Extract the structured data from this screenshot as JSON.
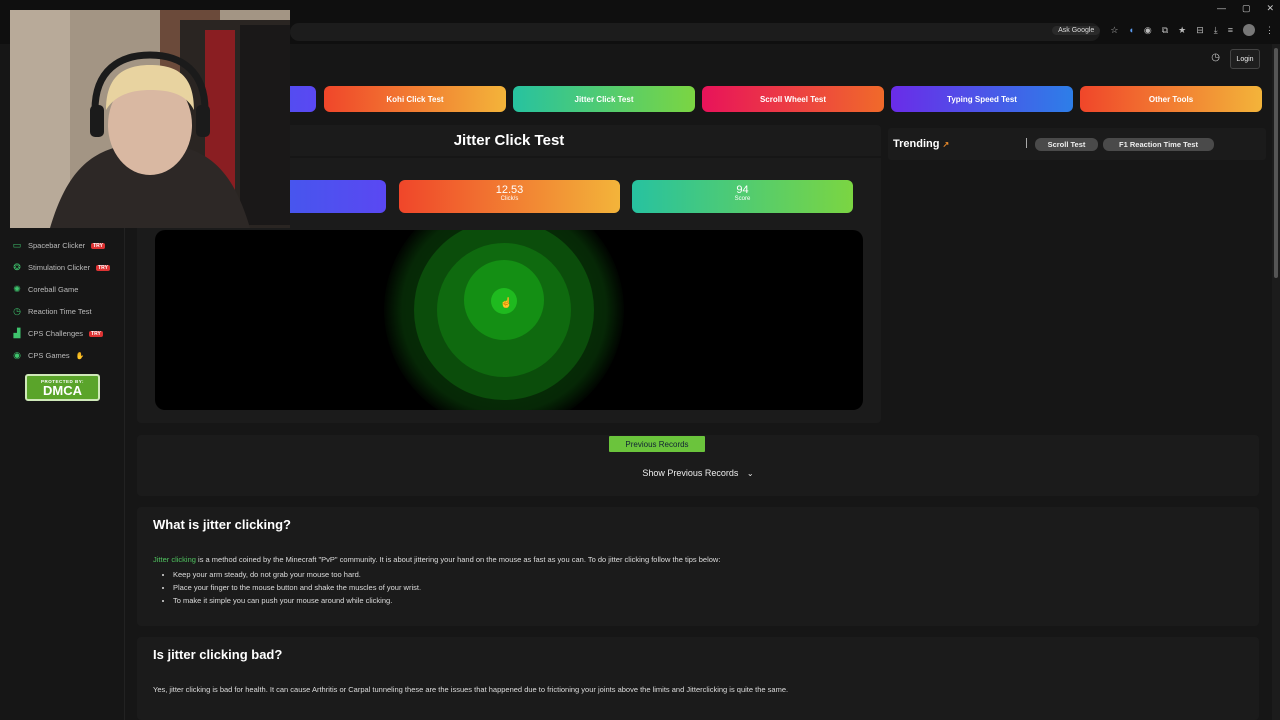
{
  "browser": {
    "window_controls": [
      "—",
      "▢",
      "✕"
    ],
    "ask_google": "Ask Google"
  },
  "header": {
    "history_icon": "history-icon",
    "login_label": "Login"
  },
  "nav_tabs": [
    {
      "label": "",
      "color_from": "#2f67e8",
      "color_to": "#5a48f2"
    },
    {
      "label": "Kohi Click Test",
      "color_from": "#f0462a",
      "color_to": "#f3b43a"
    },
    {
      "label": "Jitter Click Test",
      "color_from": "#27c2a0",
      "color_to": "#7bd542"
    },
    {
      "label": "Scroll Wheel Test",
      "color_from": "#e8135a",
      "color_to": "#f06a2a"
    },
    {
      "label": "Typing Speed Test",
      "color_from": "#6a2ce8",
      "color_to": "#2d7ee8"
    },
    {
      "label": "Other Tools",
      "color_from": "#f0462a",
      "color_to": "#f3b43a"
    }
  ],
  "test": {
    "title": "Jitter Click Test",
    "stats": [
      {
        "value": "",
        "label": ""
      },
      {
        "value": "12.53",
        "label": "Click/s"
      },
      {
        "value": "94",
        "label": "Score"
      }
    ]
  },
  "trending": {
    "title": "Trending",
    "items": [
      "Scroll Test",
      "F1 Reaction Time Test"
    ]
  },
  "sidebar": {
    "items": [
      {
        "label": "Spacebar Clicker",
        "icon": "keyboard-icon",
        "glyph": "▭",
        "badge": "TRY"
      },
      {
        "label": "Stimulation Clicker",
        "icon": "brain-icon",
        "glyph": "❂",
        "badge": "TRY"
      },
      {
        "label": "Coreball Game",
        "icon": "ball-icon",
        "glyph": "✺",
        "badge": ""
      },
      {
        "label": "Reaction Time Test",
        "icon": "clock-icon",
        "glyph": "◷",
        "badge": ""
      },
      {
        "label": "CPS Challenges",
        "icon": "chart-icon",
        "glyph": "▟",
        "badge": "TRY"
      },
      {
        "label": "CPS Games",
        "icon": "gamepad-icon",
        "glyph": "◉",
        "badge": ""
      }
    ],
    "dmca_top": "PROTECTED BY:",
    "dmca_main": "DMCA"
  },
  "records": {
    "button": "Previous Records",
    "show": "Show Previous Records"
  },
  "sections": [
    {
      "heading": "What is jitter clicking?",
      "link": "Jitter clicking",
      "text": " is a method coined by the Minecraft \"PvP\" community. It is about jittering your hand on the mouse as fast as you can. To do jitter clicking follow the tips below:",
      "bullets": [
        "Keep your arm steady, do not grab your mouse too hard.",
        "Place your finger to the mouse button and shake the muscles of your wrist.",
        "To make it simple you can push your mouse around while clicking."
      ]
    },
    {
      "heading": "Is jitter clicking bad?",
      "text": "Yes, jitter clicking is bad for health. It can cause Arthritis or Carpal tunneling these are the issues that happened due to frictioning your joints above the limits and Jitterclicking is quite the same."
    }
  ]
}
